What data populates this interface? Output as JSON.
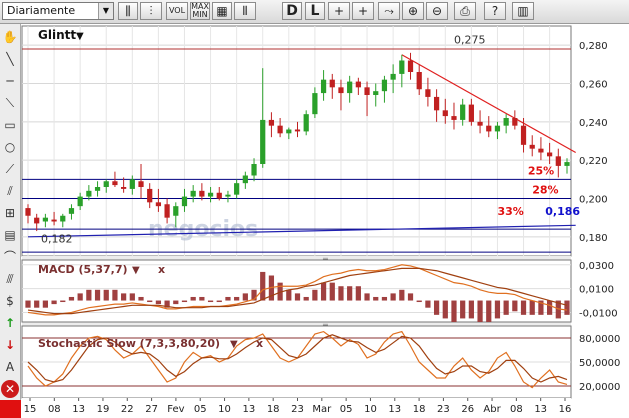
{
  "toolbar": {
    "period": "Diariamente",
    "buttons": [
      {
        "name": "candles-icon",
        "glyph": "⫼"
      },
      {
        "name": "bars-icon",
        "glyph": "⫶"
      },
      {
        "name": "volume-button",
        "label": "VOL"
      },
      {
        "name": "maxmin-button",
        "label": "MAX\nMIN"
      },
      {
        "name": "grid-icon",
        "glyph": "▦"
      },
      {
        "name": "chart-type-icon",
        "glyph": "⫴"
      },
      {
        "name": "daily-button",
        "label": "D"
      },
      {
        "name": "line-button",
        "label": "L"
      },
      {
        "name": "crosshair-icon",
        "glyph": "+"
      },
      {
        "name": "cursor-icon",
        "glyph": "+"
      },
      {
        "name": "draw-icon",
        "glyph": "⤳"
      },
      {
        "name": "zoom-in-icon",
        "glyph": "⊕"
      },
      {
        "name": "zoom-out-icon",
        "glyph": "⊖"
      },
      {
        "name": "print-icon",
        "glyph": "⎙"
      },
      {
        "name": "help-icon",
        "glyph": "?"
      },
      {
        "name": "book-icon",
        "glyph": "▥"
      }
    ]
  },
  "sidebar": {
    "tools": [
      "hand-icon",
      "line-tool-icon",
      "hline-tool-icon",
      "diag-tool-icon",
      "rect-tool-icon",
      "circle-tool-icon",
      "fan-tool-icon",
      "channel-tool-icon",
      "fibo-tool-icon",
      "grid-tool-icon",
      "arc-tool-icon",
      "parallel-tool-icon",
      "dollar-icon",
      "up-arrow-icon",
      "down-arrow-icon",
      "text-tool-icon",
      "delete-icon"
    ]
  },
  "chart_data": [
    {
      "type": "candlestick",
      "title": "Glintt",
      "yticks": [
        "0,280",
        "0,260",
        "0,240",
        "0,220",
        "0,200",
        "0,180"
      ],
      "ylim": [
        0.17,
        0.29
      ],
      "xticks": [
        "15",
        "08",
        "13",
        "19",
        "22",
        "27",
        "Fev",
        "05",
        "10",
        "13",
        "18",
        "23",
        "Mar",
        "05",
        "10",
        "13",
        "18",
        "23",
        "26",
        "Abr",
        "08",
        "13",
        "16"
      ],
      "candles": [
        [
          0.195,
          0.197,
          0.187,
          0.191
        ],
        [
          0.19,
          0.192,
          0.183,
          0.187
        ],
        [
          0.188,
          0.192,
          0.185,
          0.19
        ],
        [
          0.189,
          0.193,
          0.186,
          0.188
        ],
        [
          0.188,
          0.192,
          0.185,
          0.191
        ],
        [
          0.192,
          0.197,
          0.189,
          0.195
        ],
        [
          0.196,
          0.203,
          0.194,
          0.201
        ],
        [
          0.201,
          0.207,
          0.199,
          0.204
        ],
        [
          0.204,
          0.209,
          0.201,
          0.206
        ],
        [
          0.206,
          0.21,
          0.203,
          0.209
        ],
        [
          0.209,
          0.214,
          0.206,
          0.207
        ],
        [
          0.206,
          0.211,
          0.203,
          0.205
        ],
        [
          0.205,
          0.212,
          0.202,
          0.21
        ],
        [
          0.209,
          0.218,
          0.2,
          0.206
        ],
        [
          0.205,
          0.208,
          0.195,
          0.198
        ],
        [
          0.198,
          0.205,
          0.193,
          0.196
        ],
        [
          0.197,
          0.2,
          0.187,
          0.19
        ],
        [
          0.191,
          0.198,
          0.185,
          0.196
        ],
        [
          0.196,
          0.205,
          0.193,
          0.201
        ],
        [
          0.201,
          0.207,
          0.198,
          0.204
        ],
        [
          0.204,
          0.208,
          0.199,
          0.201
        ],
        [
          0.201,
          0.206,
          0.198,
          0.203
        ],
        [
          0.203,
          0.206,
          0.199,
          0.2
        ],
        [
          0.201,
          0.204,
          0.198,
          0.202
        ],
        [
          0.202,
          0.21,
          0.2,
          0.208
        ],
        [
          0.208,
          0.214,
          0.205,
          0.212
        ],
        [
          0.212,
          0.221,
          0.209,
          0.218
        ],
        [
          0.218,
          0.268,
          0.216,
          0.241
        ],
        [
          0.241,
          0.245,
          0.232,
          0.238
        ],
        [
          0.238,
          0.242,
          0.232,
          0.234
        ],
        [
          0.234,
          0.237,
          0.231,
          0.236
        ],
        [
          0.236,
          0.24,
          0.232,
          0.235
        ],
        [
          0.235,
          0.246,
          0.233,
          0.244
        ],
        [
          0.244,
          0.258,
          0.242,
          0.255
        ],
        [
          0.255,
          0.267,
          0.251,
          0.262
        ],
        [
          0.262,
          0.265,
          0.252,
          0.258
        ],
        [
          0.258,
          0.262,
          0.246,
          0.255
        ],
        [
          0.255,
          0.264,
          0.25,
          0.261
        ],
        [
          0.261,
          0.263,
          0.254,
          0.258
        ],
        [
          0.258,
          0.261,
          0.243,
          0.254
        ],
        [
          0.254,
          0.26,
          0.248,
          0.256
        ],
        [
          0.256,
          0.264,
          0.25,
          0.262
        ],
        [
          0.262,
          0.27,
          0.255,
          0.265
        ],
        [
          0.265,
          0.275,
          0.258,
          0.272
        ],
        [
          0.272,
          0.276,
          0.262,
          0.266
        ],
        [
          0.266,
          0.27,
          0.254,
          0.257
        ],
        [
          0.257,
          0.263,
          0.248,
          0.253
        ],
        [
          0.253,
          0.257,
          0.24,
          0.246
        ],
        [
          0.246,
          0.252,
          0.239,
          0.243
        ],
        [
          0.243,
          0.25,
          0.236,
          0.241
        ],
        [
          0.241,
          0.252,
          0.238,
          0.249
        ],
        [
          0.249,
          0.252,
          0.238,
          0.24
        ],
        [
          0.24,
          0.246,
          0.234,
          0.238
        ],
        [
          0.238,
          0.243,
          0.232,
          0.235
        ],
        [
          0.235,
          0.24,
          0.231,
          0.238
        ],
        [
          0.238,
          0.244,
          0.234,
          0.242
        ],
        [
          0.242,
          0.246,
          0.236,
          0.238
        ],
        [
          0.238,
          0.242,
          0.224,
          0.228
        ],
        [
          0.228,
          0.233,
          0.222,
          0.226
        ],
        [
          0.226,
          0.232,
          0.22,
          0.224
        ],
        [
          0.224,
          0.229,
          0.218,
          0.222
        ],
        [
          0.222,
          0.226,
          0.211,
          0.217
        ],
        [
          0.217,
          0.221,
          0.213,
          0.219
        ]
      ],
      "annotations": [
        {
          "text": "0,275",
          "x": 49,
          "y": 0.281,
          "color": "#333333"
        },
        {
          "text": "25%",
          "x": 57.5,
          "y": 0.2125,
          "color": "#e01010",
          "bold": true
        },
        {
          "text": "28%",
          "x": 58,
          "y": 0.2025,
          "color": "#e01010",
          "bold": true
        },
        {
          "text": "33%",
          "x": 54,
          "y": 0.1915,
          "color": "#e01010",
          "bold": true
        },
        {
          "text": "0,186",
          "x": 59.5,
          "y": 0.1915,
          "color": "#1010cc",
          "bold": true
        },
        {
          "text": "0,182",
          "x": 1.5,
          "y": 0.177,
          "color": "#333333"
        }
      ],
      "hlines": [
        {
          "y": 0.278,
          "color": "#b03030"
        },
        {
          "y": 0.21,
          "color": "#000080"
        },
        {
          "y": 0.2,
          "color": "#000080"
        },
        {
          "y": 0.184,
          "color": "#000080"
        },
        {
          "y": 0.172,
          "color": "#000080"
        }
      ],
      "trendlines": [
        {
          "x1": 43,
          "y1": 0.275,
          "x2": 63,
          "y2": 0.224,
          "color": "#e02020"
        },
        {
          "x1": 0,
          "y1": 0.18,
          "x2": 63,
          "y2": 0.186,
          "color": "#2020b0"
        }
      ],
      "watermark": "negocios",
      "colors": {
        "up": "#2aa02a",
        "down": "#c02020"
      }
    },
    {
      "type": "macd",
      "title": "MACD (5,37,7)",
      "yticks": [
        "0,0300",
        "0,0100",
        "-0,0100"
      ],
      "ylim": [
        -0.018,
        0.034
      ],
      "macd": [
        -0.01,
        -0.011,
        -0.012,
        -0.012,
        -0.011,
        -0.01,
        -0.008,
        -0.006,
        -0.005,
        -0.004,
        -0.003,
        -0.003,
        -0.002,
        -0.003,
        -0.004,
        -0.005,
        -0.007,
        -0.007,
        -0.006,
        -0.005,
        -0.005,
        -0.005,
        -0.005,
        -0.004,
        -0.003,
        -0.001,
        0.001,
        0.009,
        0.011,
        0.012,
        0.012,
        0.012,
        0.013,
        0.016,
        0.02,
        0.022,
        0.023,
        0.025,
        0.026,
        0.025,
        0.025,
        0.026,
        0.028,
        0.03,
        0.029,
        0.027,
        0.024,
        0.021,
        0.018,
        0.015,
        0.014,
        0.012,
        0.009,
        0.007,
        0.006,
        0.006,
        0.005,
        0.002,
        0.0,
        -0.002,
        -0.004,
        -0.007,
        -0.008
      ],
      "signal": [
        -0.008,
        -0.009,
        -0.01,
        -0.011,
        -0.011,
        -0.011,
        -0.01,
        -0.009,
        -0.008,
        -0.007,
        -0.006,
        -0.005,
        -0.004,
        -0.004,
        -0.004,
        -0.004,
        -0.005,
        -0.006,
        -0.006,
        -0.006,
        -0.006,
        -0.005,
        -0.005,
        -0.005,
        -0.004,
        -0.003,
        -0.002,
        0.001,
        0.004,
        0.007,
        0.009,
        0.01,
        0.012,
        0.013,
        0.015,
        0.017,
        0.019,
        0.021,
        0.022,
        0.023,
        0.024,
        0.025,
        0.026,
        0.027,
        0.027,
        0.027,
        0.026,
        0.025,
        0.023,
        0.021,
        0.019,
        0.017,
        0.015,
        0.013,
        0.011,
        0.01,
        0.008,
        0.006,
        0.004,
        0.002,
        0.0,
        -0.002,
        -0.004
      ],
      "colors": {
        "macd": "#e07020",
        "signal": "#a04010",
        "hist": "#a04040"
      }
    },
    {
      "type": "stochastic",
      "title": "Stochastic Slow (7,3,3,80,20)",
      "yticks": [
        "80,0000",
        "50,0000",
        "20,0000"
      ],
      "ylim": [
        5,
        95
      ],
      "k": [
        45,
        30,
        20,
        25,
        35,
        55,
        70,
        80,
        82,
        78,
        65,
        55,
        60,
        70,
        55,
        40,
        25,
        30,
        50,
        62,
        55,
        58,
        50,
        55,
        70,
        78,
        80,
        85,
        70,
        55,
        50,
        55,
        70,
        85,
        88,
        80,
        70,
        78,
        72,
        55,
        60,
        75,
        85,
        88,
        70,
        50,
        40,
        30,
        30,
        45,
        55,
        40,
        30,
        38,
        55,
        62,
        45,
        25,
        18,
        30,
        40,
        25,
        22
      ],
      "d": [
        50,
        40,
        28,
        25,
        28,
        40,
        55,
        70,
        78,
        80,
        75,
        65,
        60,
        62,
        60,
        52,
        40,
        32,
        38,
        48,
        55,
        56,
        54,
        54,
        60,
        68,
        75,
        80,
        78,
        68,
        58,
        55,
        60,
        70,
        80,
        84,
        80,
        76,
        75,
        68,
        62,
        66,
        74,
        82,
        80,
        70,
        55,
        42,
        35,
        38,
        45,
        45,
        38,
        36,
        42,
        52,
        52,
        42,
        30,
        25,
        30,
        32,
        28
      ],
      "levels": [
        80,
        20
      ],
      "colors": {
        "k": "#e07020",
        "d": "#a04010"
      }
    }
  ]
}
